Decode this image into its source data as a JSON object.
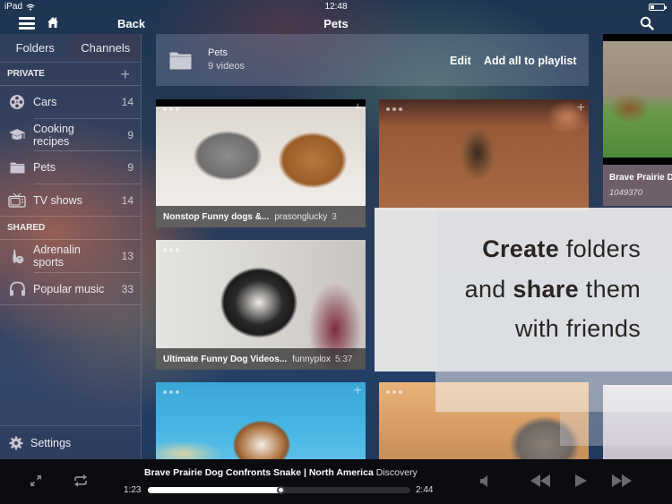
{
  "status_bar": {
    "device": "iPad",
    "time": "12:48"
  },
  "nav": {
    "back_label": "Back",
    "title": "Pets"
  },
  "sidebar": {
    "tabs": [
      {
        "label": "Folders",
        "active": false
      },
      {
        "label": "Channels",
        "active": true
      }
    ],
    "private_header": "PRIVATE",
    "private_items": [
      {
        "label": "Cars",
        "count": "14",
        "icon": "film-reel-icon"
      },
      {
        "label": "Cooking recipes",
        "count": "9",
        "icon": "graduation-cap-icon"
      },
      {
        "label": "Pets",
        "count": "9",
        "icon": "folder-icon"
      },
      {
        "label": "TV shows",
        "count": "14",
        "icon": "tv-icon"
      }
    ],
    "shared_header": "SHARED",
    "shared_items": [
      {
        "label": "Adrenalin sports",
        "count": "13",
        "icon": "bowling-icon"
      },
      {
        "label": "Popular music",
        "count": "33",
        "icon": "headphones-icon"
      }
    ],
    "settings_label": "Settings"
  },
  "folder": {
    "name": "Pets",
    "subtitle": "9 videos",
    "edit_label": "Edit",
    "add_all_label": "Add all to playlist"
  },
  "videos": [
    {
      "title": "Nonstop Funny dogs &...",
      "channel": "prasonglucky",
      "duration": "3"
    },
    {
      "title": "",
      "channel": "",
      "duration": ""
    },
    {
      "title": "Ultimate Funny Dog Videos...",
      "channel": "funnyplox",
      "duration": "5:37"
    },
    {
      "title": "",
      "channel": "",
      "duration": ""
    },
    {
      "title": "",
      "channel": "",
      "duration": ""
    }
  ],
  "side_video": {
    "title": "Brave Prairie D",
    "views": "1049370"
  },
  "promo": {
    "line1_bold": "Create",
    "line1_rest": " folders",
    "line2_pre": "and ",
    "line2_bold": "share",
    "line2_rest": " them",
    "line3": "with friends"
  },
  "player": {
    "title": "Brave Prairie Dog Confronts Snake | North America",
    "channel": "Discovery",
    "current_time": "1:23",
    "total_time": "2:44",
    "progress_fraction": 0.506
  }
}
